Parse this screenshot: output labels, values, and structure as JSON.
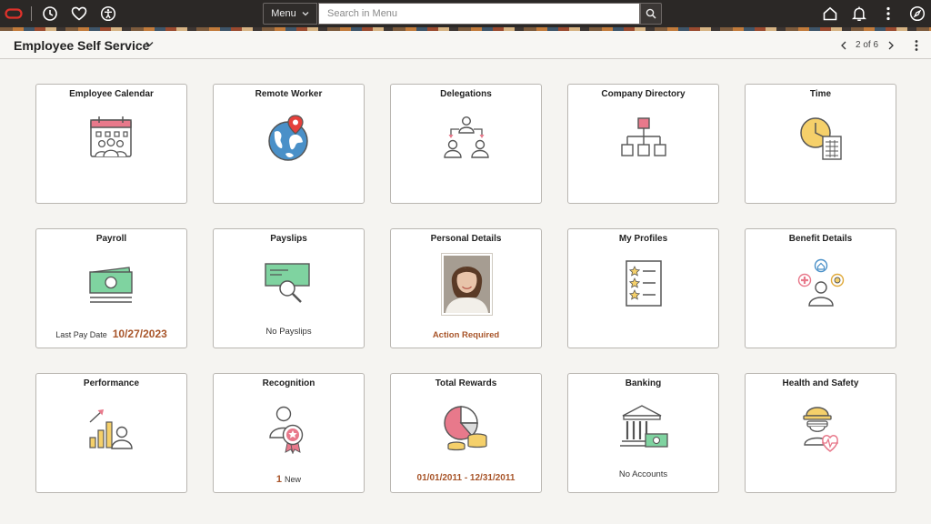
{
  "topbar": {
    "menu_label": "Menu",
    "search_placeholder": "Search in Menu"
  },
  "header": {
    "title": "Employee Self Service",
    "pager": "2 of 6"
  },
  "tiles": [
    {
      "title": "Employee Calendar",
      "icon": "calendar-people-icon"
    },
    {
      "title": "Remote Worker",
      "icon": "globe-pin-icon"
    },
    {
      "title": "Delegations",
      "icon": "delegation-people-icon"
    },
    {
      "title": "Company Directory",
      "icon": "org-chart-icon"
    },
    {
      "title": "Time",
      "icon": "clock-timesheet-icon"
    },
    {
      "title": "Payroll",
      "icon": "money-stack-icon",
      "footer_label": "Last Pay Date",
      "footer_value": "10/27/2023"
    },
    {
      "title": "Payslips",
      "icon": "check-magnifier-icon",
      "footer": "No Payslips"
    },
    {
      "title": "Personal Details",
      "icon": "profile-photo",
      "footer": "Action Required"
    },
    {
      "title": "My Profiles",
      "icon": "star-checklist-icon"
    },
    {
      "title": "Benefit Details",
      "icon": "benefits-person-icon"
    },
    {
      "title": "Performance",
      "icon": "growth-chart-person-icon"
    },
    {
      "title": "Recognition",
      "icon": "award-person-icon",
      "footer_count": "1",
      "footer_label": "New"
    },
    {
      "title": "Total Rewards",
      "icon": "pie-coins-icon",
      "footer": "01/01/2011 - 12/31/2011"
    },
    {
      "title": "Banking",
      "icon": "bank-money-icon",
      "footer": "No Accounts"
    },
    {
      "title": "Health and Safety",
      "icon": "hardhat-health-icon"
    }
  ],
  "colors": {
    "accent_orange": "#a8552a",
    "topbar_bg": "#2b2826",
    "icon_red": "#e8798b",
    "icon_green": "#7fd3a0",
    "icon_blue": "#4a90c8",
    "icon_yellow": "#f5d06a"
  }
}
